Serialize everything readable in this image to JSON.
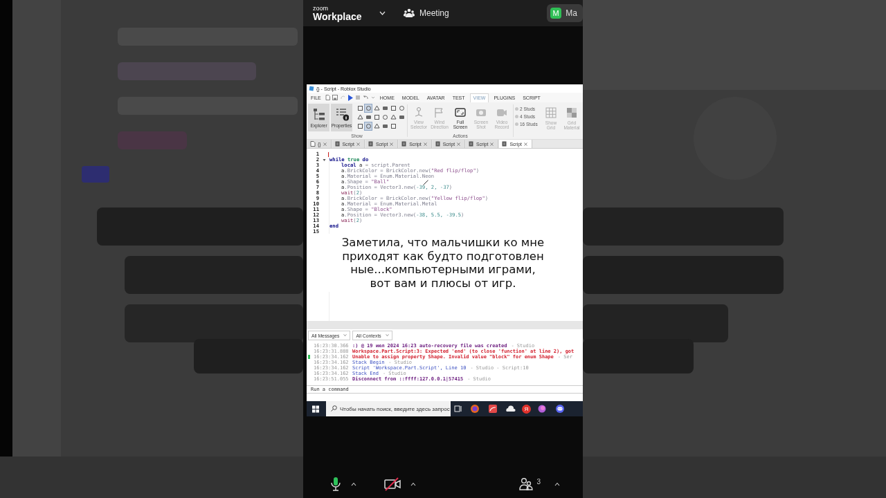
{
  "zoom_bar": {
    "brand_small": "zoom",
    "brand": "Workplace",
    "meeting": "Meeting",
    "user": {
      "initial": "M",
      "name": "Ма"
    }
  },
  "studio": {
    "title": "{} - Script - Roblox Studio",
    "menu": {
      "file": "FILE",
      "tabs": [
        {
          "label": "HOME",
          "selected": false
        },
        {
          "label": "MODEL",
          "selected": false
        },
        {
          "label": "AVATAR",
          "selected": false
        },
        {
          "label": "TEST",
          "selected": false
        },
        {
          "label": "VIEW",
          "selected": true
        },
        {
          "label": "PLUGINS",
          "selected": false
        },
        {
          "label": "SCRIPT",
          "selected": false
        }
      ]
    },
    "ribbon": {
      "panels": [
        {
          "label": "Explorer",
          "selected": true
        },
        {
          "label": "Properties",
          "selected": true
        }
      ],
      "show_toggles": [
        {
          "on": false
        },
        {
          "on": true
        },
        {
          "on": false
        },
        {
          "on": false
        },
        {
          "on": false
        },
        {
          "on": false
        },
        {
          "on": false
        },
        {
          "on": false
        },
        {
          "on": false
        },
        {
          "on": false
        },
        {
          "on": false
        },
        {
          "on": false
        },
        {
          "on": false
        },
        {
          "on": true
        },
        {
          "on": false
        },
        {
          "on": false
        },
        {
          "on": false
        }
      ],
      "show_label": "Show",
      "actions": [
        {
          "label": "View\nSelector",
          "disabled": true
        },
        {
          "label": "Wind\nDirection",
          "disabled": true
        },
        {
          "label": "Full\nScreen",
          "disabled": false
        },
        {
          "label": "Screen\nShot",
          "disabled": true
        },
        {
          "label": "Video\nRecord",
          "disabled": true
        }
      ],
      "actions_label": "Actions",
      "studs": [
        {
          "label": "2 Studs",
          "selected": false
        },
        {
          "label": "4 Studs",
          "selected": false
        },
        {
          "label": "16 Studs",
          "selected": false
        }
      ],
      "grid": [
        {
          "label": "Show\nGrid",
          "disabled": true
        },
        {
          "label": "Grid\nMaterial",
          "disabled": true
        }
      ]
    },
    "doc_tabs": [
      {
        "label": "{}",
        "kind": "place",
        "selected": false
      },
      {
        "label": "Script",
        "kind": "script",
        "selected": false
      },
      {
        "label": "Script",
        "kind": "script",
        "selected": false
      },
      {
        "label": "Script",
        "kind": "script",
        "selected": false
      },
      {
        "label": "Script",
        "kind": "script",
        "selected": false
      },
      {
        "label": "Script",
        "kind": "script",
        "selected": false
      },
      {
        "label": "Script",
        "kind": "script",
        "selected": true
      }
    ],
    "code": [
      {
        "number": "1",
        "cursor": true
      },
      {
        "number": "2",
        "tokens": [
          {
            "t": "while ",
            "kind": "kw"
          },
          {
            "t": "true ",
            "kind": "bool"
          },
          {
            "t": "do",
            "kind": "kw"
          }
        ],
        "children": [
          {
            "number": "3",
            "tokens": [
              {
                "t": "local ",
                "kind": "kw"
              },
              {
                "t": "a ",
                "kind": "id"
              },
              {
                "t": "= ",
                "kind": "op"
              },
              {
                "t": "script",
                "kind": "prop"
              },
              {
                "t": ".Parent",
                "kind": "prop"
              }
            ]
          },
          {
            "number": "4",
            "tokens": [
              {
                "t": "a",
                "kind": "id"
              },
              {
                "t": ".BrickColor = BrickColor.new(",
                "kind": "prop"
              },
              {
                "t": "\"Red flip/flop\"",
                "kind": "str"
              },
              {
                "t": ")",
                "kind": "prop"
              }
            ]
          },
          {
            "number": "5",
            "tokens": [
              {
                "t": "a",
                "kind": "id"
              },
              {
                "t": ".Material = Enum.Material.Neon",
                "kind": "prop"
              }
            ]
          },
          {
            "number": "6",
            "tokens": [
              {
                "t": "a",
                "kind": "id"
              },
              {
                "t": ".Shape = ",
                "kind": "prop"
              },
              {
                "t": "\"Ball\"",
                "kind": "str"
              }
            ]
          },
          {
            "number": "7",
            "tokens": [
              {
                "t": "a",
                "kind": "id"
              },
              {
                "t": ".Position = Vector3.new(",
                "kind": "prop"
              },
              {
                "t": "-39, 2, -37",
                "kind": "num"
              },
              {
                "t": ")",
                "kind": "prop"
              }
            ]
          },
          {
            "number": "8",
            "tokens": [
              {
                "t": "wait",
                "kind": "fn"
              },
              {
                "t": "(",
                "kind": "prop"
              },
              {
                "t": "2",
                "kind": "num"
              },
              {
                "t": ")",
                "kind": "prop"
              }
            ]
          },
          {
            "number": "9",
            "tokens": [
              {
                "t": "a",
                "kind": "id"
              },
              {
                "t": ".BrickColor = BrickColor.new(",
                "kind": "prop"
              },
              {
                "t": "\"Yellow flip/flop\"",
                "kind": "str"
              },
              {
                "t": ")",
                "kind": "prop"
              }
            ]
          },
          {
            "number": "10",
            "tokens": [
              {
                "t": "a",
                "kind": "id"
              },
              {
                "t": ".Material = Enum.Material.Metal",
                "kind": "prop"
              }
            ]
          },
          {
            "number": "11",
            "tokens": [
              {
                "t": "a",
                "kind": "id"
              },
              {
                "t": ".Shape = ",
                "kind": "prop"
              },
              {
                "t": "\"Block\"",
                "kind": "str"
              }
            ]
          },
          {
            "number": "12",
            "tokens": [
              {
                "t": "a",
                "kind": "id"
              },
              {
                "t": ".Position = Vector3.new(",
                "kind": "prop"
              },
              {
                "t": "-38, 5.5, -39.5",
                "kind": "num"
              },
              {
                "t": ")",
                "kind": "prop"
              }
            ]
          },
          {
            "number": "13",
            "tokens": [
              {
                "t": "wait",
                "kind": "fn"
              },
              {
                "t": "(",
                "kind": "prop"
              },
              {
                "t": "2",
                "kind": "num"
              },
              {
                "t": ")",
                "kind": "prop"
              }
            ]
          }
        ]
      },
      {
        "number": "14",
        "tokens": [
          {
            "t": "end",
            "kind": "kw"
          }
        ]
      },
      {
        "number": "15"
      }
    ],
    "output": {
      "filters": [
        "All Messages",
        "All Contexts"
      ],
      "lines": [
        {
          "time": "16:23:30.366",
          "kind": "info",
          "message": ":) @ 19 июл 2024 16:23 auto-recovery file was created",
          "source": "-  Studio",
          "flagged": false
        },
        {
          "time": "16:23:31.888",
          "kind": "error",
          "message": "Workspace.Part.Script:3: Expected 'end' (to close 'function' at line 2), got",
          "flagged": false
        },
        {
          "time": "16:23:34.162",
          "kind": "error",
          "message": "Unable to assign property Shape. Invalid value \"block\" for enum Shape",
          "source": "-  Ser",
          "flagged": true
        },
        {
          "time": "16:23:34.162",
          "kind": "stack",
          "message": "Stack Begin",
          "source": "-  Studio",
          "flagged": false
        },
        {
          "time": "16:23:34.162",
          "kind": "stack",
          "message": "Script 'Workspace.Part.Script', Line 10",
          "source": "-  Studio - Script:10",
          "flagged": false
        },
        {
          "time": "16:23:34.162",
          "kind": "stack",
          "message": "Stack End",
          "source": "-  Studio",
          "flagged": false
        },
        {
          "time": "16:23:51.055",
          "kind": "info",
          "message": "Disconnect from ::ffff:127.0.0.1|57415",
          "source": "-  Studio",
          "flagged": false
        }
      ],
      "command_placeholder": "Run a command"
    },
    "taskbar": {
      "search_placeholder": "Чтобы начать поиск, введите здесь запрос",
      "browser_letter": "Я"
    }
  },
  "caption": "Заметила, что мальчишки ко мне приходят как будто подготовлен ные...компьютерными играми, вот вам и плюсы от игр.",
  "controls": {
    "audio_on": true,
    "video_on": false,
    "participants": "3"
  }
}
